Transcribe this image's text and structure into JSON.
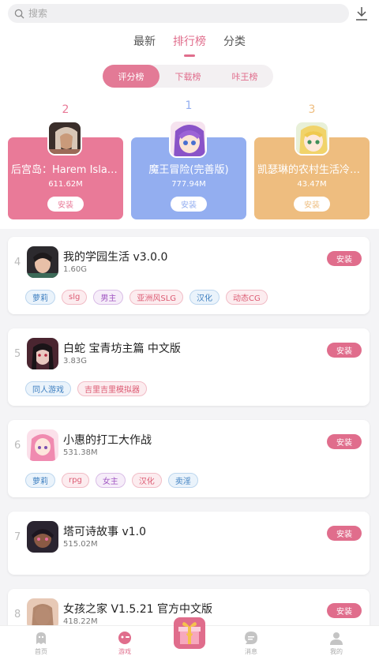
{
  "search": {
    "placeholder": "搜索"
  },
  "tabs": [
    {
      "label": "最新"
    },
    {
      "label": "排行榜"
    },
    {
      "label": "分类"
    }
  ],
  "segments": [
    {
      "label": "评分榜"
    },
    {
      "label": "下载榜"
    },
    {
      "label": "咔王榜"
    }
  ],
  "top3": [
    {
      "rank": "2",
      "title": "后宫岛：Harem Island",
      "size": "611.62M",
      "install_label": "安装",
      "color": "#e97a98"
    },
    {
      "rank": "1",
      "title": "魔王冒险(完善版)",
      "size": "777.94M",
      "install_label": "安装",
      "color": "#93aef0"
    },
    {
      "rank": "3",
      "title": "凯瑟琳的农村生活冷静版",
      "size": "43.47M",
      "install_label": "安装",
      "color": "#eebd7f"
    }
  ],
  "list": [
    {
      "rank": "4",
      "name": "我的学园生活  v3.0.0",
      "size": "1.60G",
      "install_label": "安装",
      "tags": [
        {
          "label": "萝莉",
          "style": "blue"
        },
        {
          "label": "slg",
          "style": "pink"
        },
        {
          "label": "男主",
          "style": "purple"
        },
        {
          "label": "亚洲风SLG",
          "style": "pink"
        },
        {
          "label": "汉化",
          "style": "blue"
        },
        {
          "label": "动态CG",
          "style": "pink"
        }
      ]
    },
    {
      "rank": "5",
      "name": "白蛇 宝青坊主篇 中文版",
      "size": "3.83G",
      "install_label": "安装",
      "tags": [
        {
          "label": "同人游戏",
          "style": "blue"
        },
        {
          "label": "吉里吉里模拟器",
          "style": "pink"
        }
      ]
    },
    {
      "rank": "6",
      "name": "小惠的打工大作战",
      "size": "531.38M",
      "install_label": "安装",
      "tags": [
        {
          "label": "萝莉",
          "style": "blue"
        },
        {
          "label": "rpg",
          "style": "pink"
        },
        {
          "label": "女主",
          "style": "purple"
        },
        {
          "label": "汉化",
          "style": "pink"
        },
        {
          "label": "卖淫",
          "style": "blue"
        }
      ]
    },
    {
      "rank": "7",
      "name": "塔可诗故事  v1.0",
      "size": "515.02M",
      "install_label": "安装",
      "tags": []
    },
    {
      "rank": "8",
      "name": "女孩之家 V1.5.21 官方中文版",
      "size": "418.22M",
      "install_label": "安装",
      "tags": []
    }
  ],
  "bottom_nav": [
    {
      "label": "首页",
      "icon": "ghost-icon"
    },
    {
      "label": "游戏",
      "icon": "gamepad-icon"
    },
    {
      "label": "消息",
      "icon": "message-icon"
    },
    {
      "label": "我的",
      "icon": "user-icon"
    }
  ],
  "colors": {
    "accent": "#e06d8c"
  }
}
